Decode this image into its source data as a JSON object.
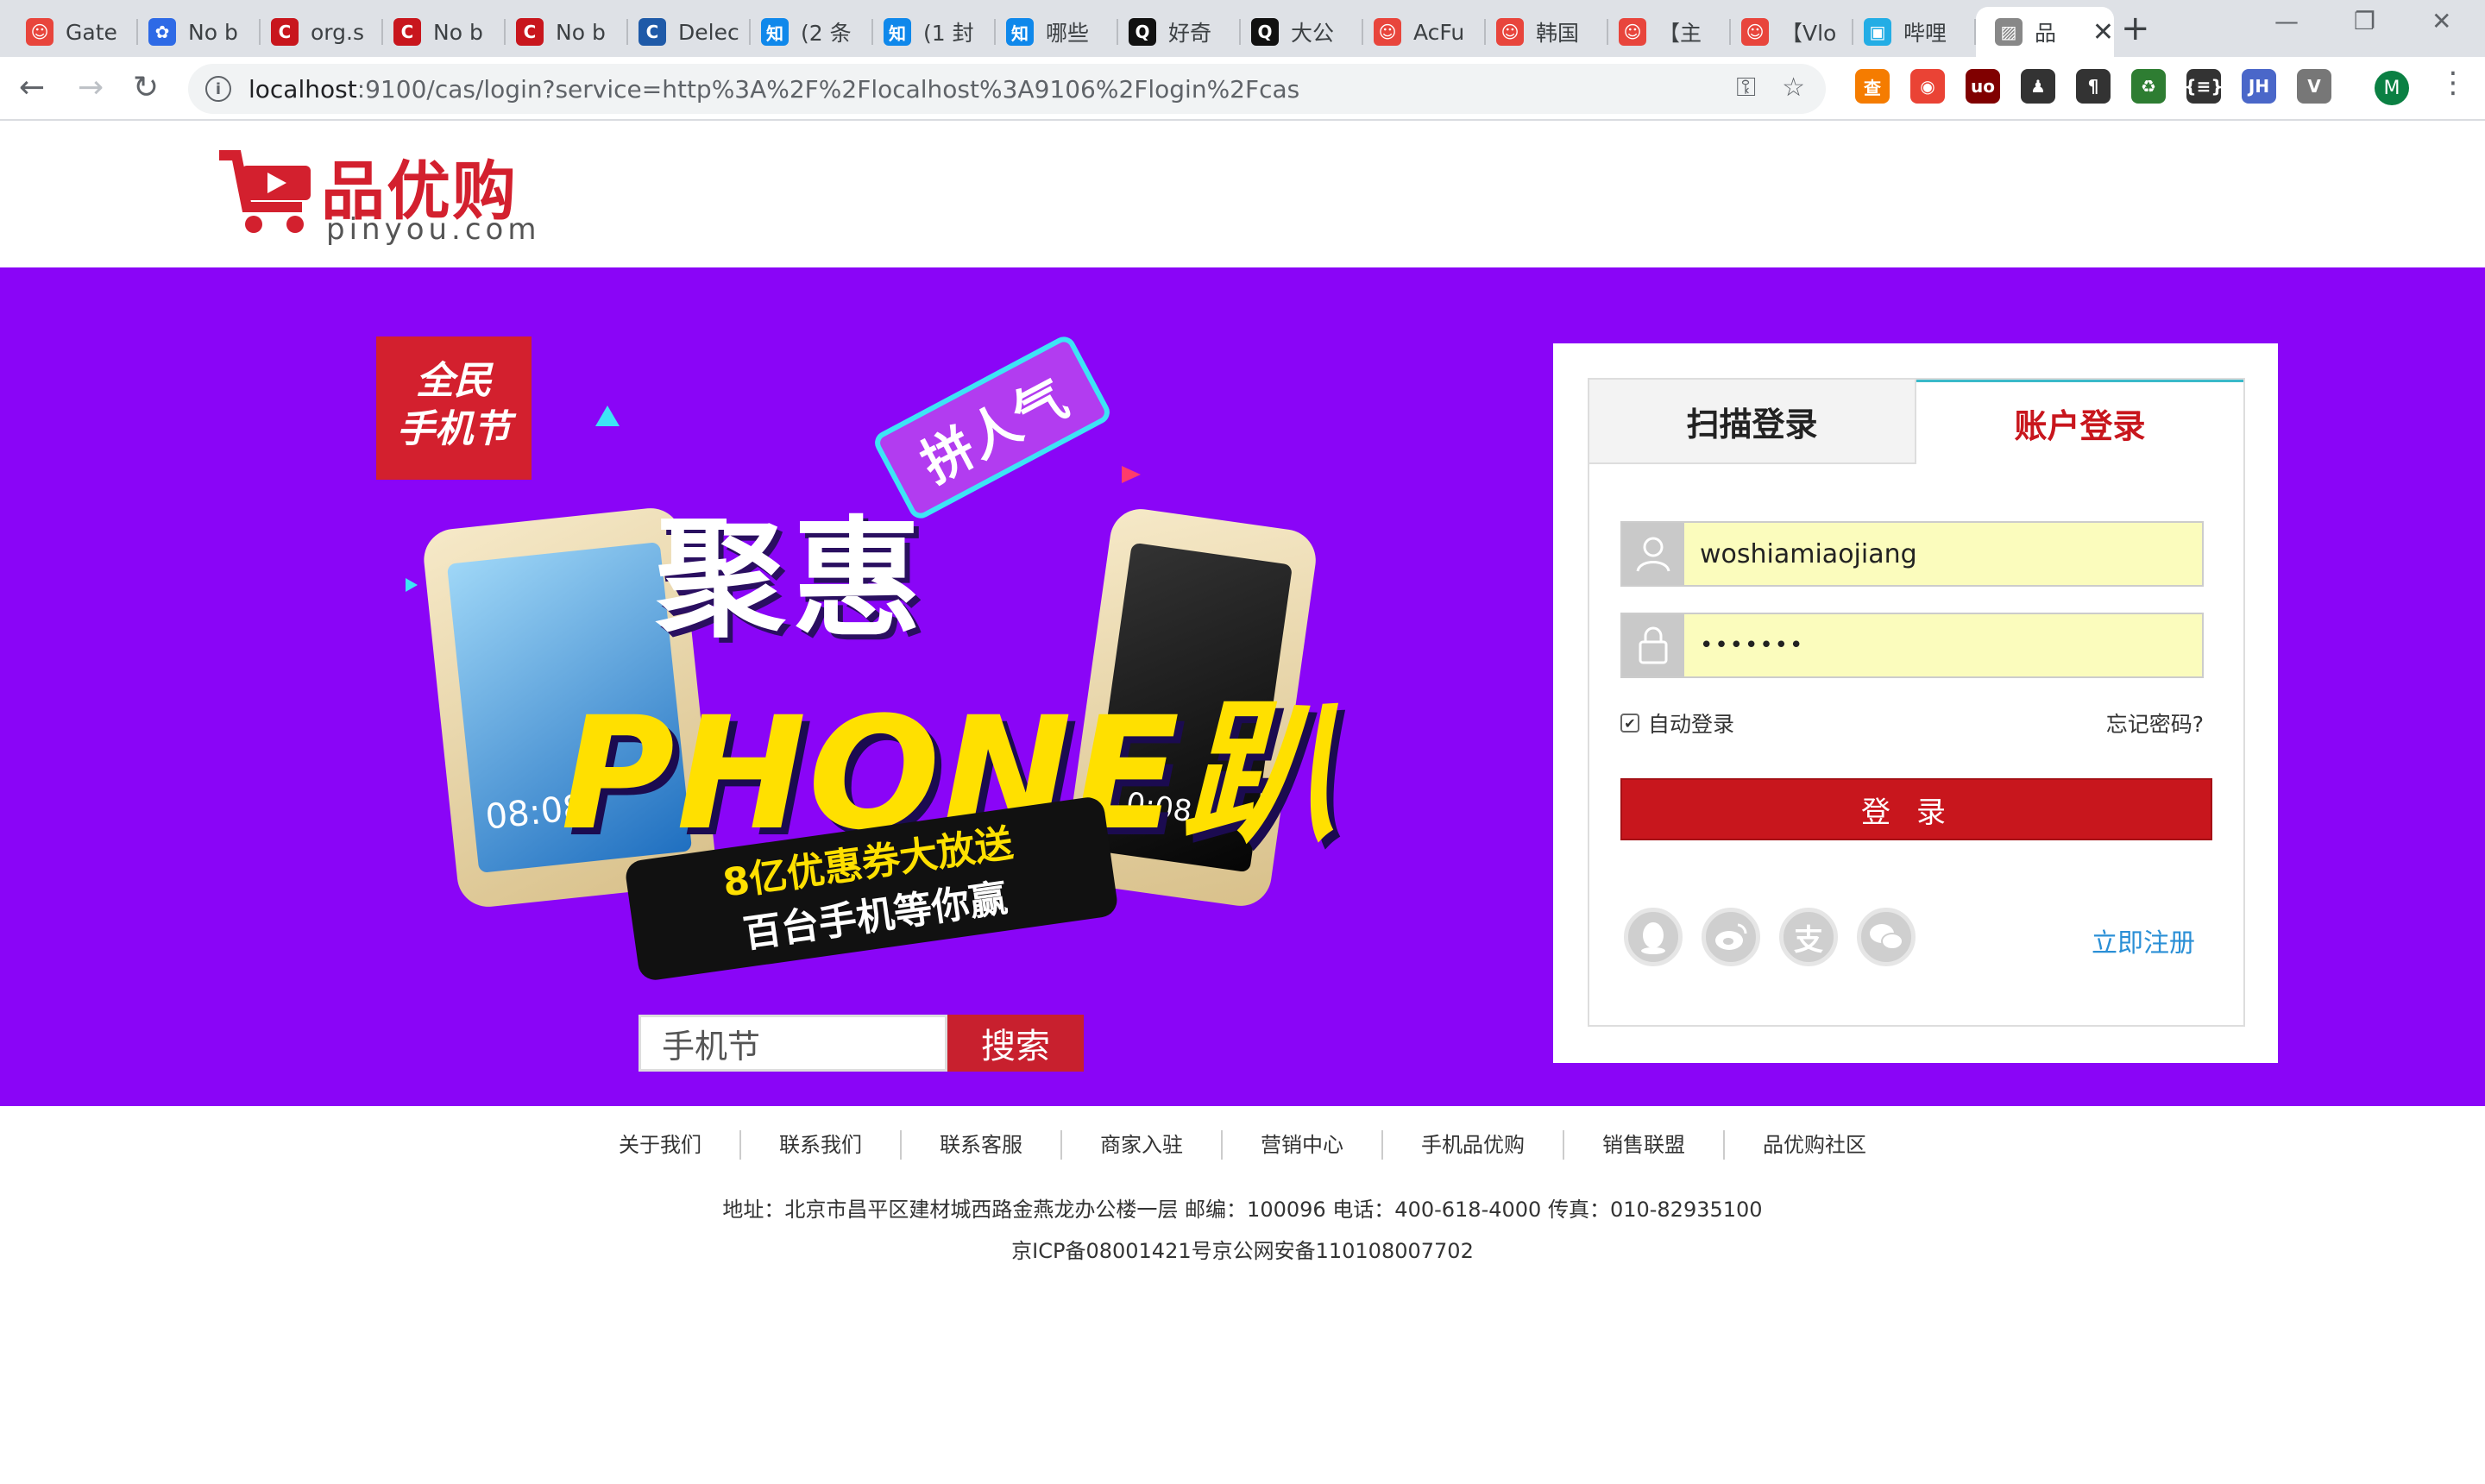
{
  "browser": {
    "tabs": [
      {
        "label": "Gate",
        "color": "#e8453c",
        "glyph": "☺"
      },
      {
        "label": "No b",
        "color": "#2e6ae6",
        "glyph": "✿"
      },
      {
        "label": "org.s",
        "color": "#c8161d",
        "glyph": "C"
      },
      {
        "label": "No b",
        "color": "#c8161d",
        "glyph": "C"
      },
      {
        "label": "No b",
        "color": "#c8161d",
        "glyph": "C"
      },
      {
        "label": "Delec",
        "color": "#1f5aa8",
        "glyph": "C"
      },
      {
        "label": "(2 条",
        "color": "#0f88eb",
        "glyph": "知"
      },
      {
        "label": "(1 封",
        "color": "#0f88eb",
        "glyph": "知"
      },
      {
        "label": "哪些",
        "color": "#0f88eb",
        "glyph": "知"
      },
      {
        "label": "好奇",
        "color": "#111111",
        "glyph": "Q"
      },
      {
        "label": "大公",
        "color": "#111111",
        "glyph": "Q"
      },
      {
        "label": "AcFu",
        "color": "#e8453c",
        "glyph": "☺"
      },
      {
        "label": "韩国",
        "color": "#e8453c",
        "glyph": "☺"
      },
      {
        "label": "【主",
        "color": "#e8453c",
        "glyph": "☺"
      },
      {
        "label": "【Vlo",
        "color": "#e8453c",
        "glyph": "☺"
      },
      {
        "label": "哔哩",
        "color": "#23ade5",
        "glyph": "▣"
      },
      {
        "label": "品",
        "color": "#888888",
        "glyph": "▨"
      }
    ],
    "new_tab": "+",
    "url_host": "localhost",
    "url_path": ":9100/cas/login?service=http%3A%2F%2Flocalhost%3A9106%2Flogin%2Fcas",
    "profile_initial": "M",
    "extensions": [
      {
        "glyph": "查",
        "color": "#f57c00"
      },
      {
        "glyph": "◉",
        "color": "#ea4335"
      },
      {
        "glyph": "uo",
        "color": "#800000"
      },
      {
        "glyph": "♟",
        "color": "#333333"
      },
      {
        "glyph": "¶",
        "color": "#333333"
      },
      {
        "glyph": "♻",
        "color": "#2e7d32"
      },
      {
        "glyph": "{≡}",
        "color": "#333333"
      },
      {
        "glyph": "JH",
        "color": "#4a67c9"
      },
      {
        "glyph": "V",
        "color": "#777777"
      }
    ]
  },
  "site": {
    "brand": "品优购",
    "domain": "pinyou.com"
  },
  "banner": {
    "badge_line1": "全民",
    "badge_line2": "手机节",
    "ribbon": "拼人气",
    "title": "聚惠",
    "headline": "PHONE趴",
    "strip_line1": "8亿优惠券大放送",
    "strip_line2": "百台手机等你赢",
    "phone_left_time": "08:08",
    "phone_right_time": "10:08",
    "search_value": "手机节",
    "search_button": "搜索"
  },
  "login": {
    "tab_qr": "扫描登录",
    "tab_account": "账户登录",
    "username": "woshiamiaojiang",
    "password_mask": "•••••••",
    "remember_label": "自动登录",
    "remember_checked": true,
    "forgot_label": "忘记密码?",
    "submit_label": "登录",
    "register_label": "立即注册",
    "social": [
      "qq-icon",
      "weibo-icon",
      "alipay-icon",
      "wechat-icon"
    ]
  },
  "footer": {
    "links": [
      "关于我们",
      "联系我们",
      "联系客服",
      "商家入驻",
      "营销中心",
      "手机品优购",
      "销售联盟",
      "品优购社区"
    ],
    "address": "地址：北京市昌平区建材城西路金燕龙办公楼一层 邮编：100096 电话：400-618-4000 传真：010-82935100",
    "icp": "京ICP备08001421号京公网安备110108007702"
  }
}
